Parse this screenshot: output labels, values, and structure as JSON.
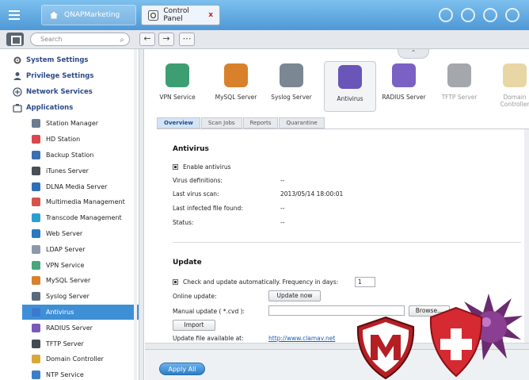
{
  "topbar": {
    "home_tab": "QNAPMarketing",
    "active_tab": "Control Panel",
    "close_glyph": "x"
  },
  "subbar": {
    "search_placeholder": "Search",
    "back_glyph": "←",
    "forward_glyph": "→",
    "grid_glyph": "⋯"
  },
  "sidebar": {
    "sections": [
      {
        "label": "System Settings",
        "icon": "gear-icon"
      },
      {
        "label": "Privilege Settings",
        "icon": "user-icon"
      },
      {
        "label": "Network Services",
        "icon": "network-icon"
      },
      {
        "label": "Applications",
        "icon": "applications-icon"
      }
    ],
    "items": [
      {
        "label": "Station Manager",
        "color": "#6a7c8e"
      },
      {
        "label": "HD Station",
        "color": "#d9474f"
      },
      {
        "label": "Backup Station",
        "color": "#3b6fb0"
      },
      {
        "label": "iTunes Server",
        "color": "#4a4f57"
      },
      {
        "label": "DLNA Media Server",
        "color": "#2f6fb8"
      },
      {
        "label": "Multimedia Management",
        "color": "#d4544c"
      },
      {
        "label": "Transcode Management",
        "color": "#2c9fd1"
      },
      {
        "label": "Web Server",
        "color": "#2a7ac0"
      },
      {
        "label": "LDAP Server",
        "color": "#8a9aa8"
      },
      {
        "label": "VPN Service",
        "color": "#4aa67a"
      },
      {
        "label": "MySQL Server",
        "color": "#d9812a"
      },
      {
        "label": "Syslog Server",
        "color": "#5b6a7c"
      },
      {
        "label": "Antivirus",
        "color": "#3a7ad0"
      },
      {
        "label": "RADIUS Server",
        "color": "#7a5ab8"
      },
      {
        "label": "TFTP Server",
        "color": "#444a52"
      },
      {
        "label": "Domain Controller",
        "color": "#d8a83a"
      },
      {
        "label": "NTP Service",
        "color": "#3b7ec8"
      }
    ],
    "selected_index": 12
  },
  "apps": [
    {
      "label": "VPN Service",
      "color": "#3e9e73"
    },
    {
      "label": "MySQL Server",
      "color": "#d9812a"
    },
    {
      "label": "Syslog Server",
      "color": "#7c8794"
    },
    {
      "label": "Antivirus",
      "color": "#6a55b8"
    },
    {
      "label": "RADIUS Server",
      "color": "#7b61c4"
    },
    {
      "label": "TFTP Server",
      "color": "#5a6068"
    },
    {
      "label": "Domain Controller",
      "color": "#d6b45a"
    }
  ],
  "subtabs": [
    "Overview",
    "Scan Jobs",
    "Reports",
    "Quarantine"
  ],
  "antivirus": {
    "heading": "Antivirus",
    "enable_label": "Enable antivirus",
    "virus_defs_label": "Virus definitions:",
    "virus_defs_value": "--",
    "last_scan_label": "Last virus scan:",
    "last_scan_value": "2013/05/14 18:00:01",
    "last_infected_label": "Last infected file found:",
    "last_infected_value": "--",
    "status_label": "Status:",
    "status_value": "--"
  },
  "update": {
    "heading": "Update",
    "auto_label": "Check and update automatically. Frequency in days:",
    "frequency_value": "1",
    "online_label": "Online update:",
    "update_now_button": "Update now",
    "manual_label": "Manual update ( *.cvd ):",
    "browse_button": "Browse...",
    "import_button": "Import",
    "file_available_label": "Update file available at:",
    "file_available_link": "http://www.clamav.net"
  },
  "bottom": {
    "apply_all": "Apply All"
  }
}
